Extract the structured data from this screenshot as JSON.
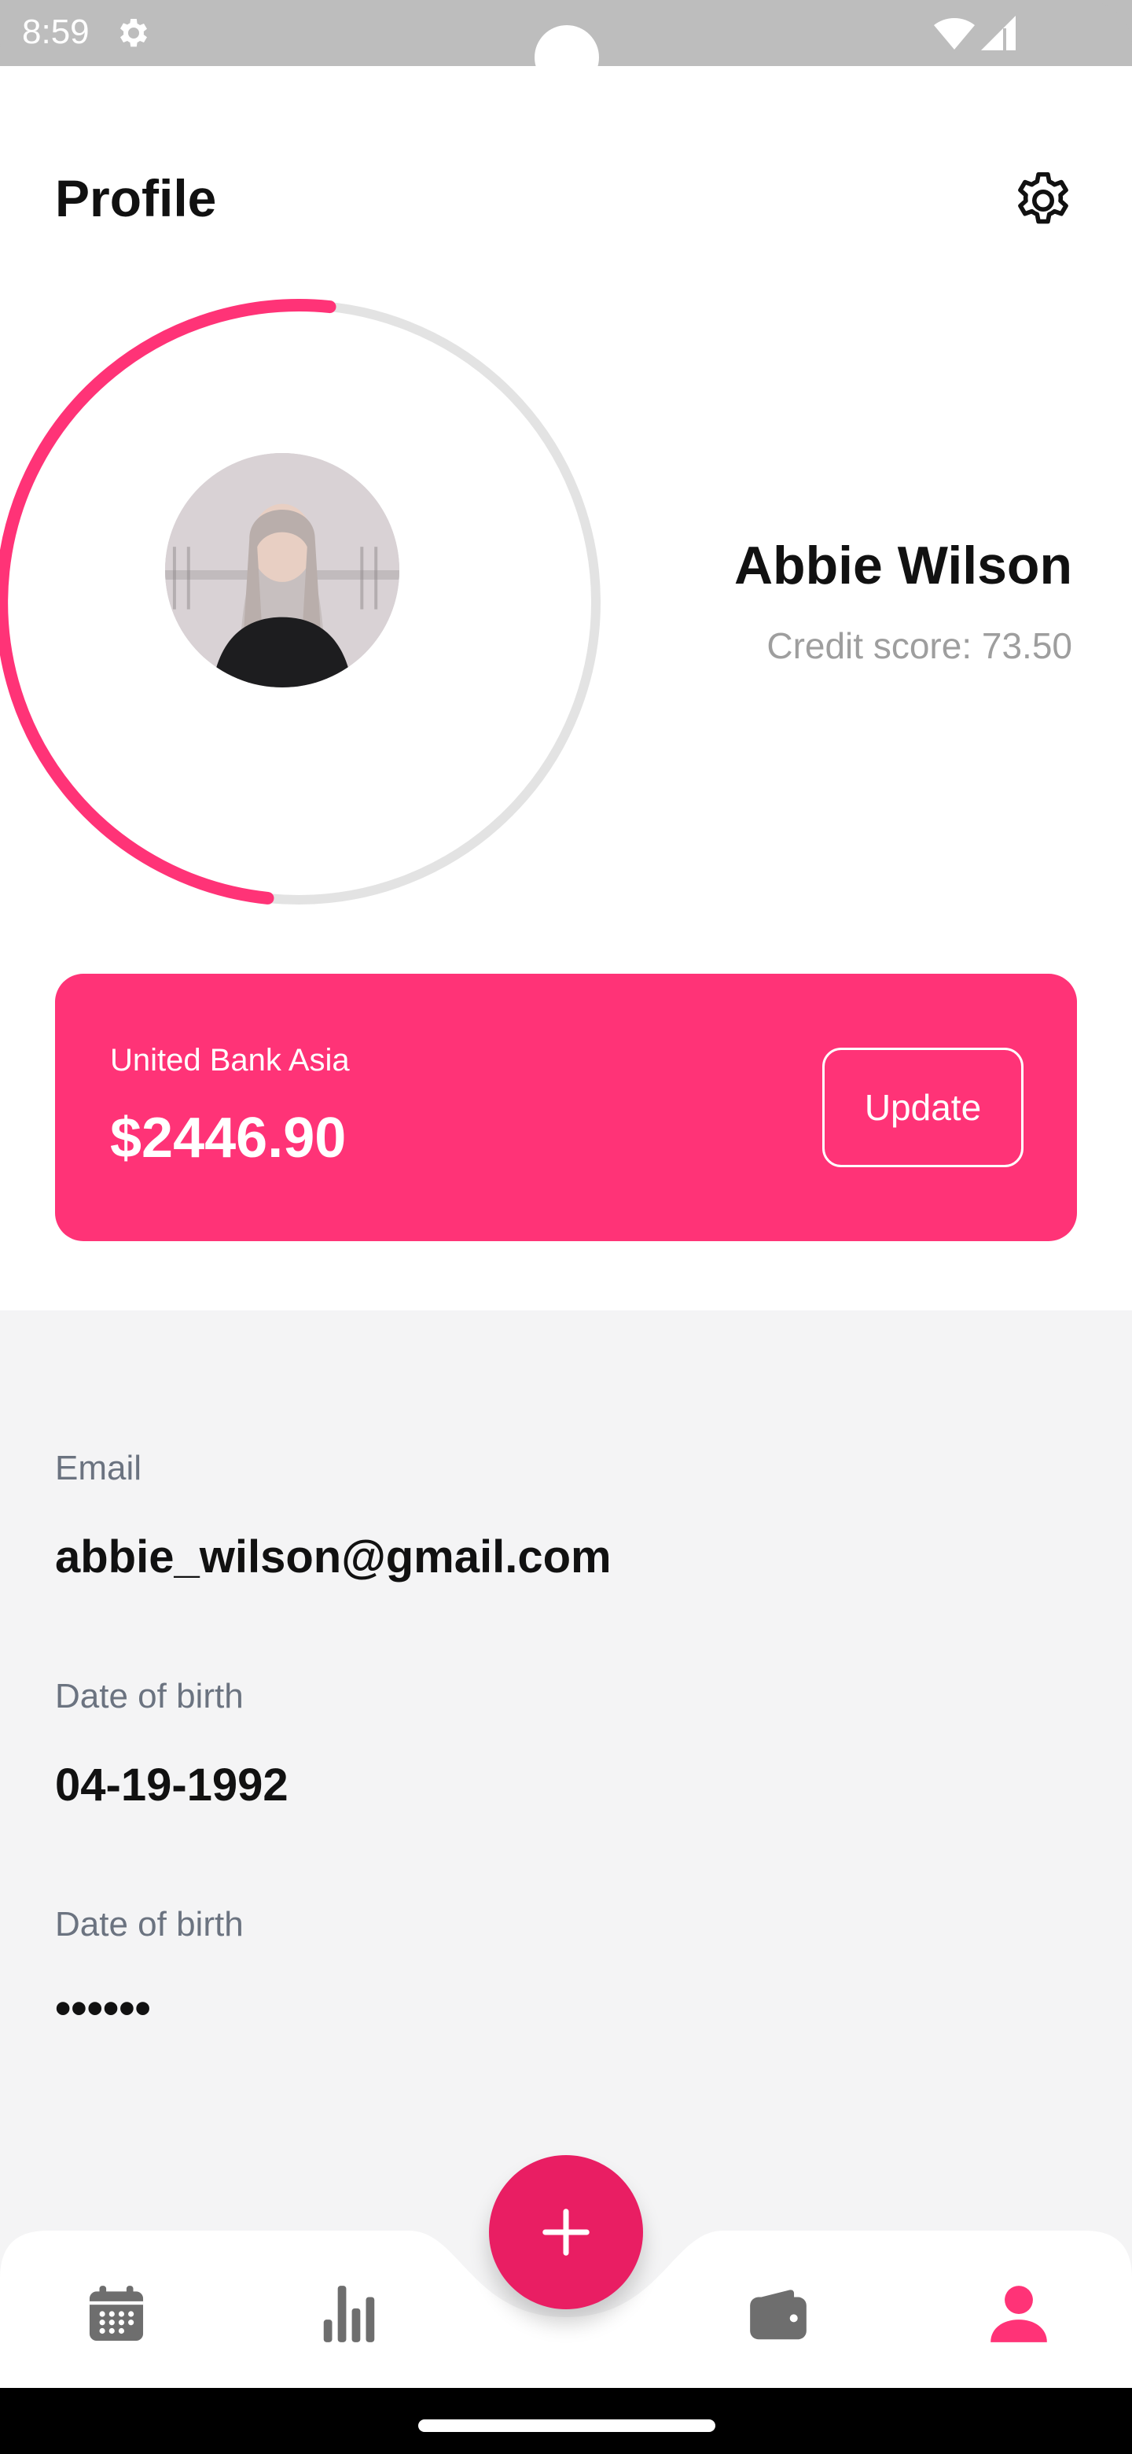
{
  "status_bar": {
    "time": "8:59",
    "icons": [
      "settings-icon",
      "wifi-icon",
      "signal-icon"
    ]
  },
  "header": {
    "title": "Profile",
    "settings_icon": "gear-icon"
  },
  "profile": {
    "name": "Abbie Wilson",
    "credit_label": "Credit score:",
    "credit_value": "73.50",
    "credit_ring_fraction": 0.5,
    "ring_color": "#ff3377",
    "ring_track_color": "#e3e3e3"
  },
  "bank_card": {
    "bank_name": "United Bank Asia",
    "balance": "$2446.90",
    "update_label": "Update",
    "color": "#ff3377"
  },
  "fields": [
    {
      "label": "Email",
      "value": "abbie_wilson@gmail.com"
    },
    {
      "label": "Date of birth",
      "value": "04-19-1992"
    },
    {
      "label": "Date of birth",
      "value": "••••••"
    }
  ],
  "bottom_nav": {
    "items": [
      {
        "icon": "calendar-icon",
        "active": false
      },
      {
        "icon": "bar-chart-icon",
        "active": false
      },
      {
        "icon": "wallet-icon",
        "active": false
      },
      {
        "icon": "person-icon",
        "active": true
      }
    ],
    "fab_icon": "plus-icon",
    "active_color": "#ff3377",
    "inactive_color": "#6e6e6e",
    "fab_color": "#e91e63"
  }
}
